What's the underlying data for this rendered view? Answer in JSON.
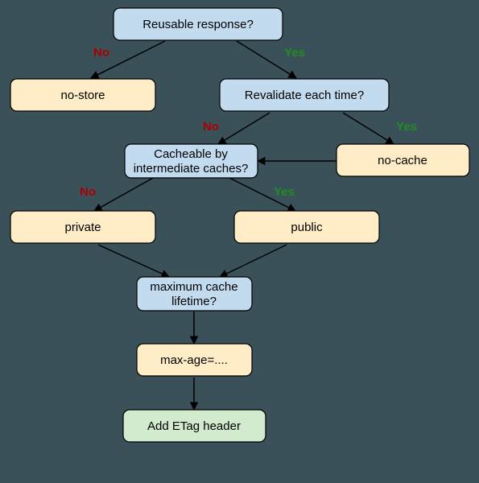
{
  "nodes": {
    "reusable": {
      "label": "Reusable response?"
    },
    "revalidate": {
      "label": "Revalidate each time?"
    },
    "cacheable_intermediate_l1": "Cacheable by",
    "cacheable_intermediate_l2": "intermediate caches?",
    "maxlifetime_l1": "maximum cache",
    "maxlifetime_l2": "lifetime?",
    "no_store": {
      "label": "no-store"
    },
    "no_cache": {
      "label": "no-cache"
    },
    "private": {
      "label": "private"
    },
    "public": {
      "label": "public"
    },
    "max_age": {
      "label": "max-age=...."
    },
    "etag": {
      "label": "Add ETag header"
    }
  },
  "edges": {
    "no": "No",
    "yes": "Yes"
  }
}
